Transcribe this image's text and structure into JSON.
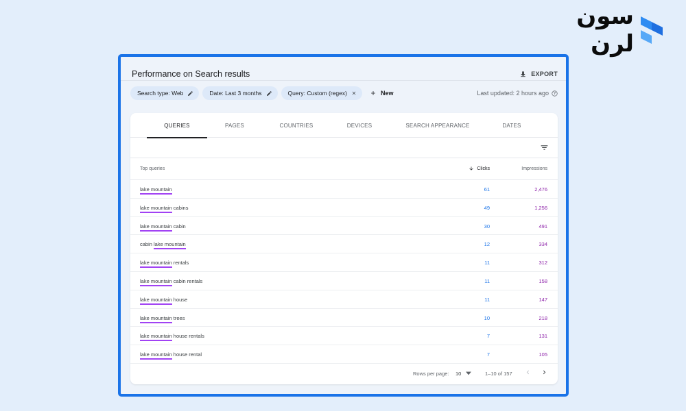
{
  "brand": {
    "logo_text": "سون لرن"
  },
  "header": {
    "title": "Performance on Search results",
    "export_label": "EXPORT"
  },
  "filters": {
    "chips": [
      {
        "label": "Search type: Web",
        "action": "edit"
      },
      {
        "label": "Date: Last 3 months",
        "action": "edit"
      },
      {
        "label": "Query: Custom (regex)",
        "action": "remove"
      }
    ],
    "new_label": "New",
    "last_updated": "Last updated: 2 hours ago"
  },
  "tabs": [
    {
      "label": "QUERIES",
      "active": true
    },
    {
      "label": "PAGES",
      "active": false
    },
    {
      "label": "COUNTRIES",
      "active": false
    },
    {
      "label": "DEVICES",
      "active": false
    },
    {
      "label": "SEARCH APPEARANCE",
      "active": false
    },
    {
      "label": "DATES",
      "active": false
    }
  ],
  "table": {
    "headers": {
      "query": "Top queries",
      "clicks": "Clicks",
      "impressions": "Impressions"
    },
    "rows": [
      {
        "pre": "",
        "match": "lake mountain",
        "post": "",
        "clicks": "61",
        "impressions": "2,476"
      },
      {
        "pre": "",
        "match": "lake mountain",
        "post": " cabins",
        "clicks": "49",
        "impressions": "1,256"
      },
      {
        "pre": "",
        "match": "lake mountain",
        "post": " cabin",
        "clicks": "30",
        "impressions": "491"
      },
      {
        "pre": "cabin ",
        "match": "lake mountain",
        "post": "",
        "clicks": "12",
        "impressions": "334"
      },
      {
        "pre": "",
        "match": "lake mountain",
        "post": " rentals",
        "clicks": "11",
        "impressions": "312"
      },
      {
        "pre": "",
        "match": "lake mountain",
        "post": " cabin rentals",
        "clicks": "11",
        "impressions": "158"
      },
      {
        "pre": "",
        "match": "lake mountain",
        "post": " house",
        "clicks": "11",
        "impressions": "147"
      },
      {
        "pre": "",
        "match": "lake mountain",
        "post": " trees",
        "clicks": "10",
        "impressions": "218"
      },
      {
        "pre": "",
        "match": "lake mountain",
        "post": " house rentals",
        "clicks": "7",
        "impressions": "131"
      },
      {
        "pre": "",
        "match": "lake mountain",
        "post": " house rental",
        "clicks": "7",
        "impressions": "105"
      }
    ]
  },
  "pagination": {
    "rows_per_page_label": "Rows per page:",
    "rows_per_page": "10",
    "range": "1–10 of 157"
  },
  "colors": {
    "accent": "#1a73e8",
    "clicks": "#1a73e8",
    "impressions": "#8e24aa",
    "highlight": "#a142f4"
  }
}
